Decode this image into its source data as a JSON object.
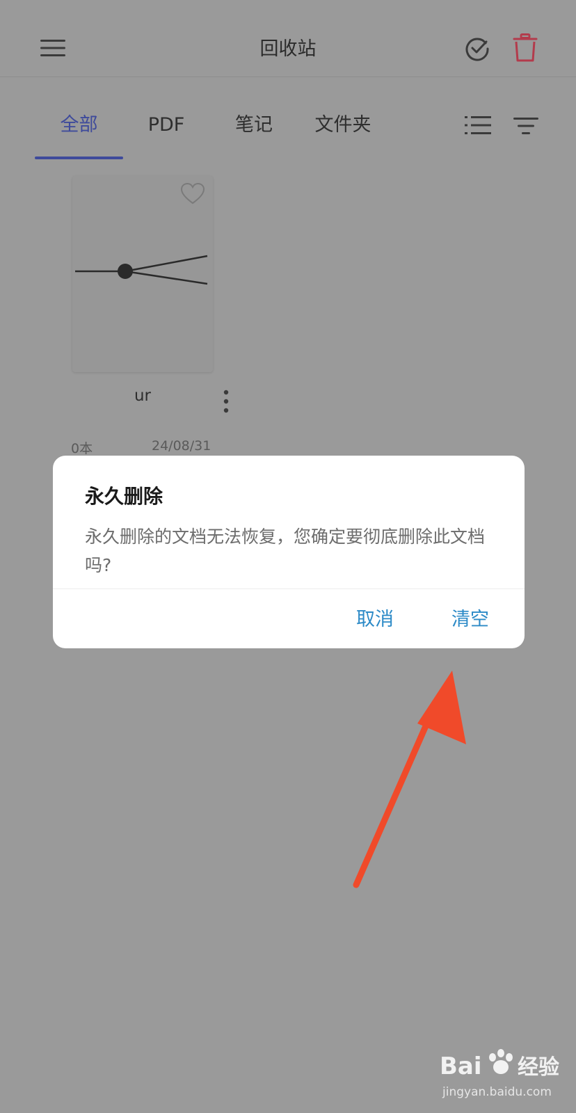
{
  "header": {
    "title": "回收站",
    "icons": {
      "menu": "menu-icon",
      "select": "check-circle-icon",
      "delete": "trash-icon"
    },
    "trash_color": "#b33b4c"
  },
  "tabs": [
    {
      "label": "全部",
      "active": true
    },
    {
      "label": "PDF",
      "active": false
    },
    {
      "label": "笔记",
      "active": false
    },
    {
      "label": "文件夹",
      "active": false
    }
  ],
  "toolbar_icons": {
    "list": "list-view-icon",
    "sort": "sort-icon"
  },
  "accent_color": "#3e4a9b",
  "file": {
    "name": "ur",
    "count": "0本",
    "date": "24/08/31",
    "favorited": false
  },
  "dialog": {
    "title": "永久删除",
    "message": "永久删除的文档无法恢复，您确定要彻底删除此文档吗?",
    "cancel_label": "取消",
    "confirm_label": "清空",
    "button_color": "#2c8ac7"
  },
  "annotation": {
    "arrow_color": "#f04a2a"
  },
  "watermark": {
    "brand": "Bai经验",
    "url": "jingyan.baidu.com"
  }
}
